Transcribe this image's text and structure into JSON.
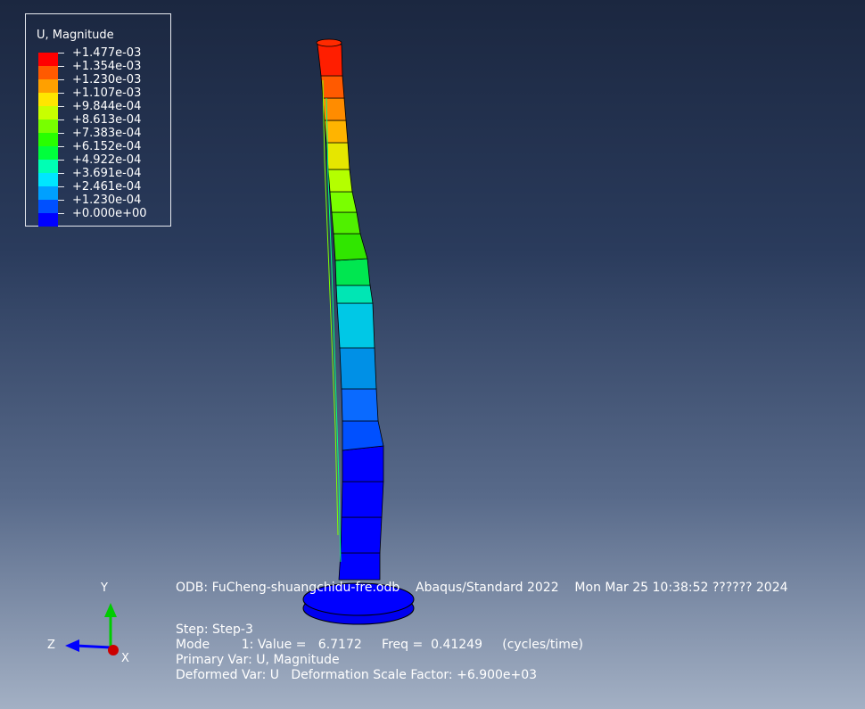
{
  "legend": {
    "title": "U, Magnitude",
    "entries": [
      {
        "value": "+1.477e-03",
        "color": "#ff0000"
      },
      {
        "value": "+1.354e-03",
        "color": "#ff5a00"
      },
      {
        "value": "+1.230e-03",
        "color": "#ffa000"
      },
      {
        "value": "+1.107e-03",
        "color": "#ffe600"
      },
      {
        "value": "+9.844e-04",
        "color": "#c8ff00"
      },
      {
        "value": "+8.613e-04",
        "color": "#78ff00"
      },
      {
        "value": "+7.383e-04",
        "color": "#28ff00"
      },
      {
        "value": "+6.152e-04",
        "color": "#00ff3c"
      },
      {
        "value": "+4.922e-04",
        "color": "#00ffb4"
      },
      {
        "value": "+3.691e-04",
        "color": "#00e6ff"
      },
      {
        "value": "+2.461e-04",
        "color": "#00a0ff"
      },
      {
        "value": "+1.230e-04",
        "color": "#0050ff"
      },
      {
        "value": "+0.000e+00",
        "color": "#0000ff"
      }
    ]
  },
  "info": {
    "odb_line": "ODB: FuCheng-shuangchidu-fre.odb    Abaqus/Standard 2022    Mon Mar 25 10:38:52 ?????? 2024",
    "step_line": "Step: Step-3",
    "mode_line": "Mode        1: Value =   6.7172     Freq =  0.41249     (cycles/time)",
    "primary_var_line": "Primary Var: U, Magnitude",
    "deformed_var_line": "Deformed Var: U   Deformation Scale Factor: +6.900e+03"
  },
  "triad": {
    "y_label": "Y",
    "z_label": "Z",
    "x_label": "X",
    "y_color": "#00cc00",
    "z_color": "#0000ff",
    "x_color": "#cc0000"
  }
}
